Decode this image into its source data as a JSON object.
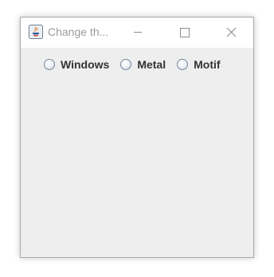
{
  "window": {
    "title": "Change th..."
  },
  "controls": {
    "minimize_icon": "minimize-icon",
    "maximize_icon": "maximize-icon",
    "close_icon": "close-icon"
  },
  "look_and_feel": {
    "options": [
      {
        "label": "Windows",
        "selected": false
      },
      {
        "label": "Metal",
        "selected": false
      },
      {
        "label": "Motif",
        "selected": false
      }
    ]
  },
  "colors": {
    "background": "#eeeeee",
    "titlebar": "#ffffff",
    "title_text": "#9a9a9a"
  }
}
